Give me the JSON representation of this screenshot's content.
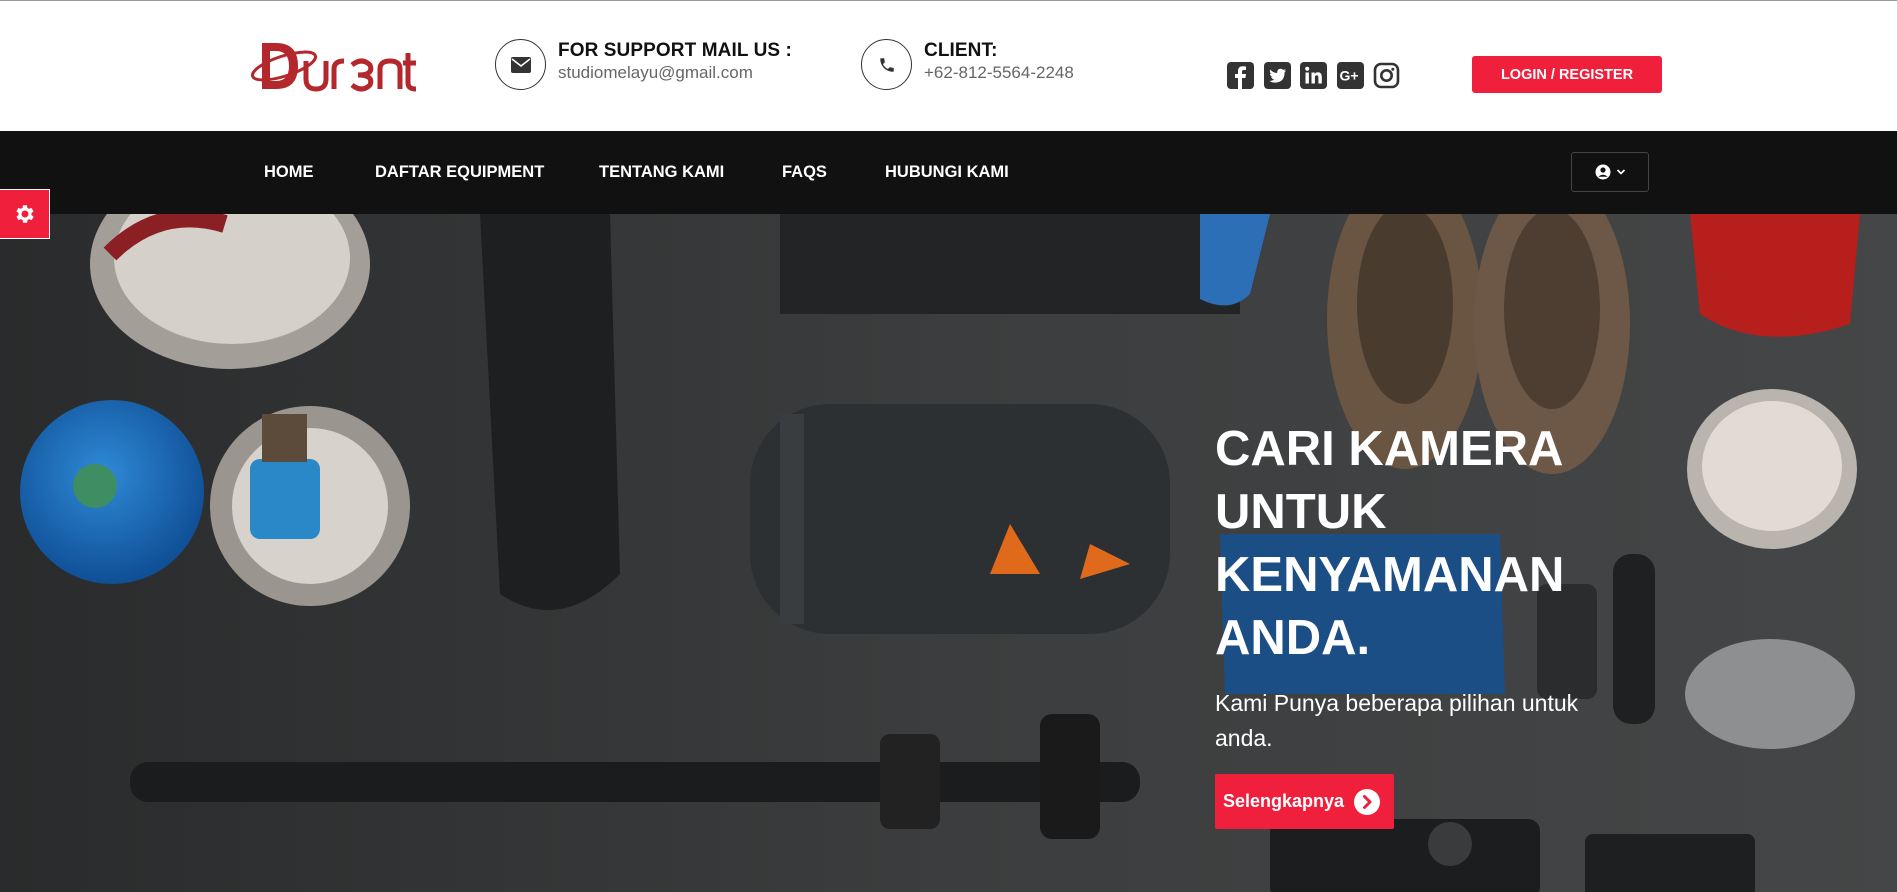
{
  "brand": {
    "logo_text": "Durent",
    "accent_color": "#f0203c",
    "nav_bg": "#111111"
  },
  "header": {
    "support": {
      "icon": "envelope-icon",
      "title": "FOR SUPPORT MAIL US :",
      "value": "studiomelayu@gmail.com"
    },
    "client": {
      "icon": "phone-icon",
      "title": "CLIENT:",
      "value": "+62-812-5564-2248"
    },
    "socials": [
      {
        "icon": "facebook-icon"
      },
      {
        "icon": "twitter-icon"
      },
      {
        "icon": "linkedin-icon"
      },
      {
        "icon": "google-plus-icon"
      },
      {
        "icon": "instagram-icon"
      }
    ],
    "login_label": "LOGIN / REGISTER"
  },
  "nav": {
    "items": [
      {
        "label": "HOME"
      },
      {
        "label": "DAFTAR EQUIPMENT"
      },
      {
        "label": "TENTANG KAMI"
      },
      {
        "label": "FAQS"
      },
      {
        "label": "HUBUNGI KAMI"
      }
    ],
    "user_menu": {
      "icon": "user-circle-icon",
      "caret": "chevron-down-icon"
    }
  },
  "hero": {
    "title": "CARI KAMERA\nUNTUK\nKENYAMANAN\nANDA.",
    "subtitle": "Kami Punya beberapa pilihan untuk anda.",
    "button_label": "Selengkapnya",
    "button_icon": "chevron-right-circle-icon"
  },
  "settings_tab": {
    "icon": "gear-icon"
  }
}
